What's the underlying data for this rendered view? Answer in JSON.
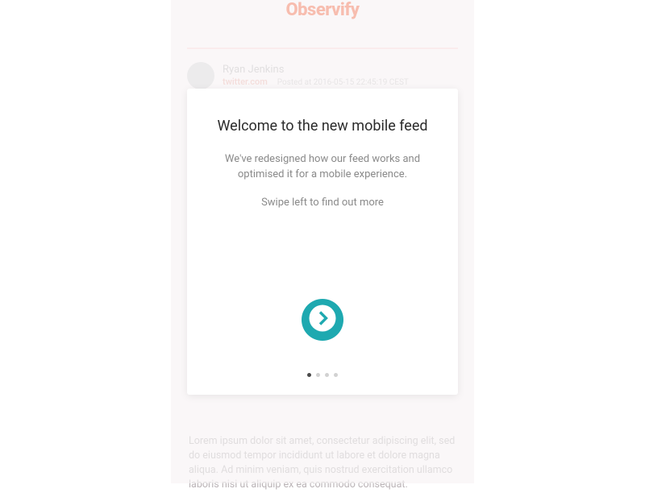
{
  "app": {
    "title": "Observify"
  },
  "feed": {
    "post": {
      "author": "Ryan Jenkins",
      "source": "twitter.com",
      "timestamp_label": "Posted at 2016-05-15 22:45:19 CEST",
      "body": "Lorem ipsum dolor sit amet, consectetur adipiscing elit, sed do eiusmod tempor incididunt ut labore et dolore magna aliqua. Ad minim veniam, quis nostrud exercitation ullamco laboris nisi ut aliquip ex ea commodo consequat."
    }
  },
  "onboarding": {
    "title": "Welcome to the new mobile feed",
    "paragraph1": "We've redesigned how our feed works and optimised it for a mobile experience.",
    "paragraph2": "Swipe left to find out more",
    "total_steps": 4,
    "current_step": 1
  }
}
